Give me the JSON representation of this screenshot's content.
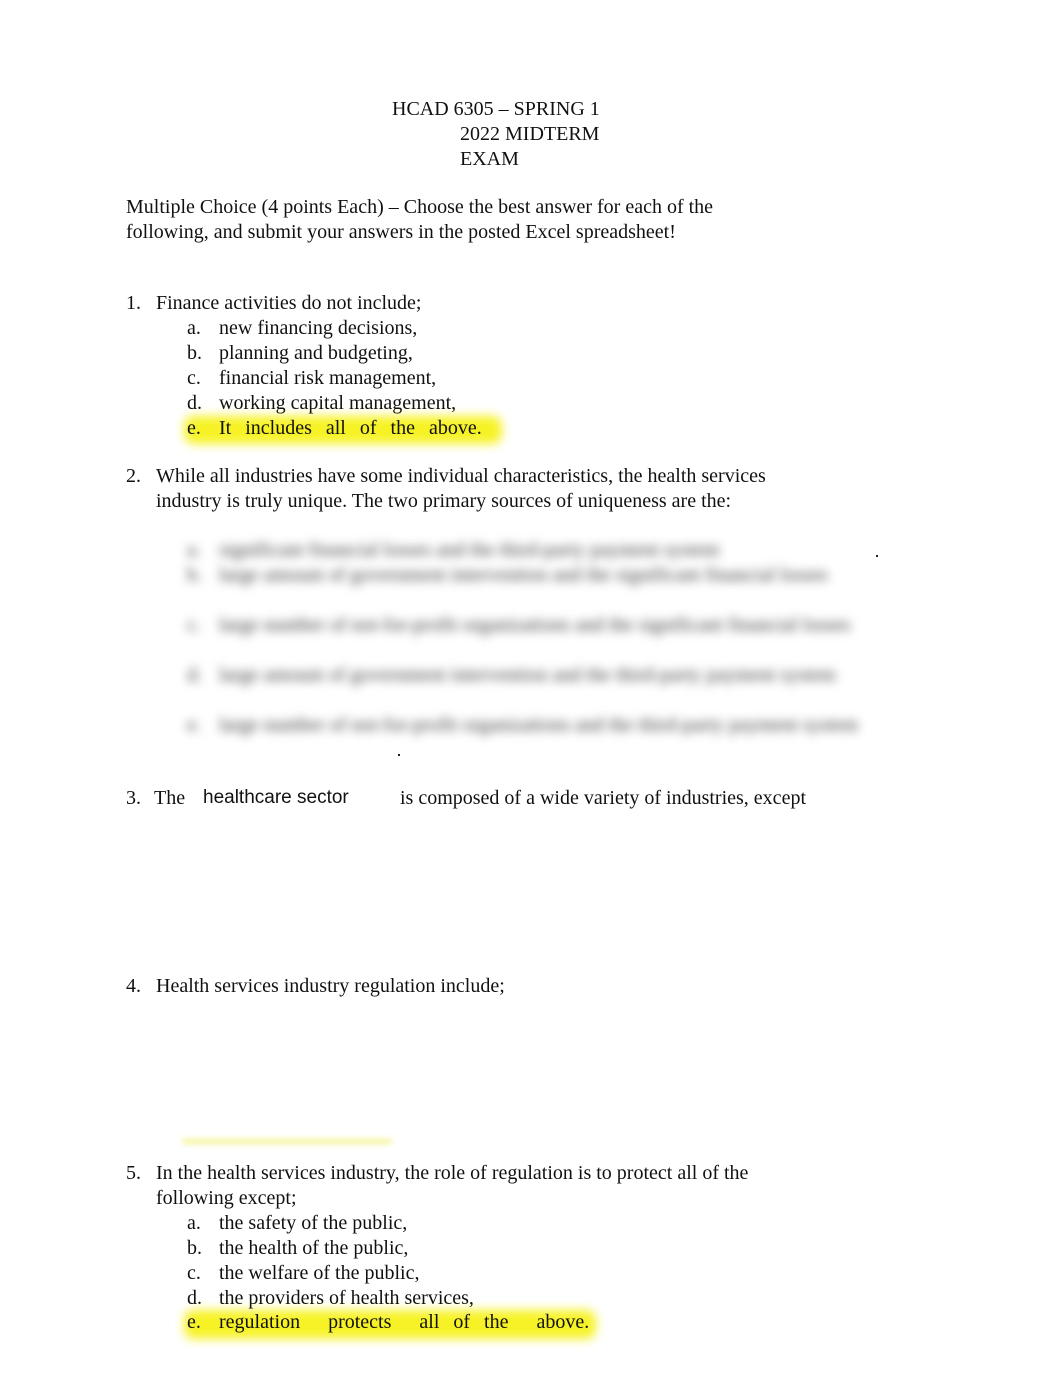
{
  "title": {
    "line1": "HCAD 6305 – SPRING 1",
    "line2": "2022 MIDTERM",
    "line3": "EXAM"
  },
  "instructions": "Multiple Choice (4 points Each) – Choose the best answer for each of the following, and submit your answers in the posted Excel spreadsheet!",
  "questions": [
    {
      "number": "1.",
      "text": "Finance activities do not include;",
      "options": [
        {
          "letter": "a.",
          "text": "new financing decisions,"
        },
        {
          "letter": "b.",
          "text": "planning and budgeting,"
        },
        {
          "letter": "c.",
          "text": "financial risk management,"
        },
        {
          "letter": "d.",
          "text": "working capital management,"
        },
        {
          "letter": "e.",
          "text": "It includes  all of the above.",
          "highlighted": true
        }
      ]
    },
    {
      "number": "2.",
      "text": "While all industries have some individual characteristics, the health services industry is truly unique. The two primary sources of uniqueness are the:",
      "options_obscured": true,
      "options": [
        {
          "letter": "a.",
          "text": "significant financial losses and the third-party payment system",
          "blurred": true
        },
        {
          "letter": "b.",
          "text": "large amount of government intervention and the significant financial losses",
          "blurred": true
        },
        {
          "letter": "c.",
          "text": "large number of not-for-profit organizations and the significant financial losses",
          "blurred": true
        },
        {
          "letter": "d.",
          "text": "large amount of government intervention and the third-party payment system",
          "blurred": true
        },
        {
          "letter": "e.",
          "text": "large number of not-for-profit organizations and the third-party payment system",
          "blurred": true
        }
      ]
    },
    {
      "number": "3.",
      "text_before": "The",
      "text_inline": "healthcare sector",
      "text_after": "is composed of a wide variety of industries, except",
      "options_hidden": true
    },
    {
      "number": "4.",
      "text": "Health services industry regulation include;",
      "options_hidden": true
    },
    {
      "number": "5.",
      "text": "In the health services industry, the role of regulation is to protect all of the following except;",
      "options": [
        {
          "letter": "a.",
          "text": "the safety of the public,"
        },
        {
          "letter": "b.",
          "text": "the health of the public,"
        },
        {
          "letter": "c.",
          "text": "the welfare of the public,"
        },
        {
          "letter": "d.",
          "text": "the providers of health services,"
        },
        {
          "letter": "e.",
          "text": "regulation  protects  all of the  above.",
          "highlighted": true
        }
      ]
    }
  ],
  "colors": {
    "highlight": "#f6f21a",
    "text": "#111111"
  }
}
